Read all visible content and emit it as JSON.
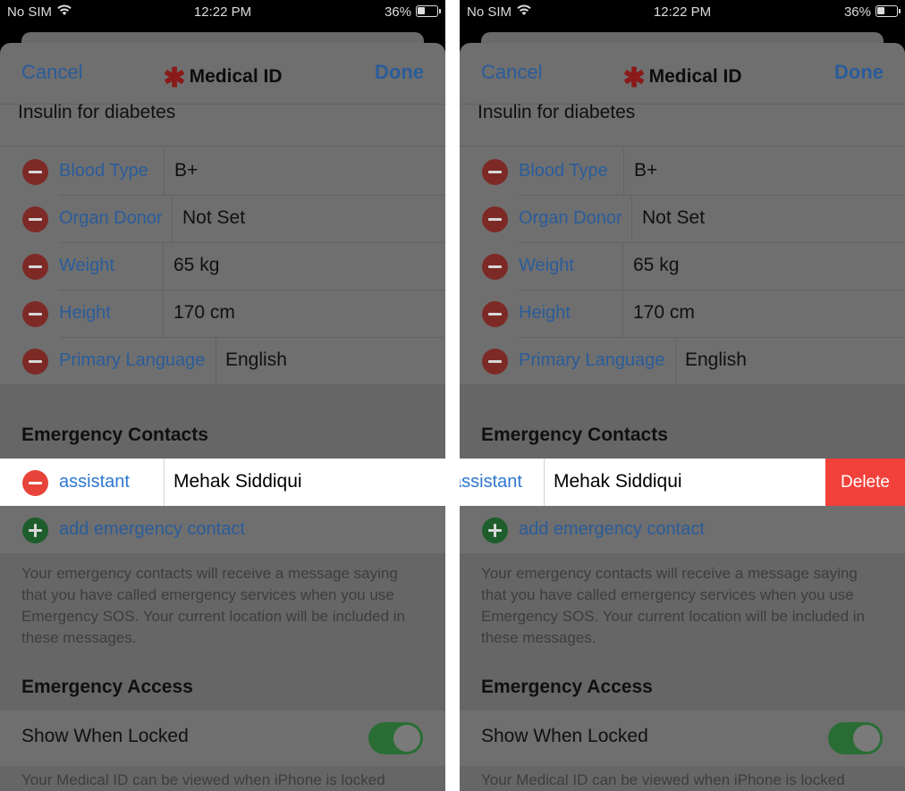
{
  "status": {
    "carrier": "No SIM",
    "time": "12:22 PM",
    "battery": "36%",
    "battery_level": 0.36
  },
  "nav": {
    "cancel": "Cancel",
    "title": "Medical ID",
    "done": "Done"
  },
  "medications_text": "Insulin for diabetes",
  "fields": [
    {
      "label": "Blood Type",
      "value": "B+"
    },
    {
      "label": "Organ Donor",
      "value": "Not Set"
    },
    {
      "label": "Weight",
      "value": "65 kg"
    },
    {
      "label": "Height",
      "value": "170 cm"
    },
    {
      "label": "Primary Language",
      "value": "English"
    }
  ],
  "emergency_contacts": {
    "header": "Emergency Contacts",
    "contact": {
      "relation": "assistant",
      "name": "Mehak Siddiqui"
    },
    "delete_label": "Delete",
    "add_label": "add emergency contact",
    "footnote": "Your emergency contacts will receive a message saying that you have called emergency services when you use Emergency SOS. Your current location will be included in these messages."
  },
  "emergency_access": {
    "header": "Emergency Access",
    "show_when_locked": "Show When Locked",
    "show_when_locked_on": true,
    "footnote": "Your Medical ID can be viewed when iPhone is locked"
  }
}
